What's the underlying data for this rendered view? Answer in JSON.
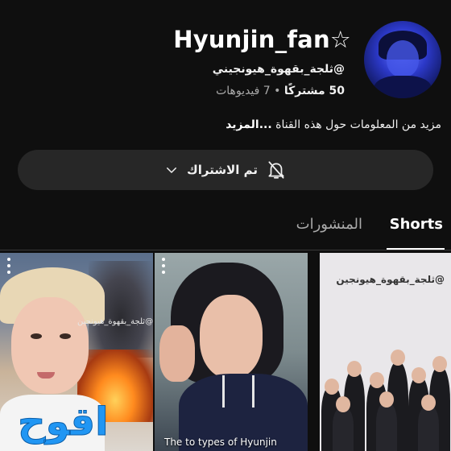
{
  "channel": {
    "name": "Hyunjin_fan☆",
    "handle": "@ثلجة_بقهوة_هيونجيني",
    "subscribers": "50 مشتركًا",
    "separator": "•",
    "videos": "7 فيديوهات",
    "description": "مزيد من المعلومات حول هذه القناة",
    "more_label": "...المزيد"
  },
  "subscribe": {
    "label": "تم الاشتراك"
  },
  "tabs": [
    {
      "label": "Shorts",
      "selected": true
    },
    {
      "label": "المنشورات",
      "selected": false
    }
  ],
  "shorts": [
    {
      "watermark": "@ثلجة_بقهوة_هيونجين",
      "overlay_text": "اقوح"
    },
    {
      "caption": "The to types of Hyunjin"
    },
    {
      "watermark": "@ثلجة_بقهوة_هيونجين"
    }
  ],
  "colors": {
    "background": "#0f0f0f",
    "pill": "#272727",
    "text": "#f1f1f1",
    "muted": "#aaaaaa"
  }
}
